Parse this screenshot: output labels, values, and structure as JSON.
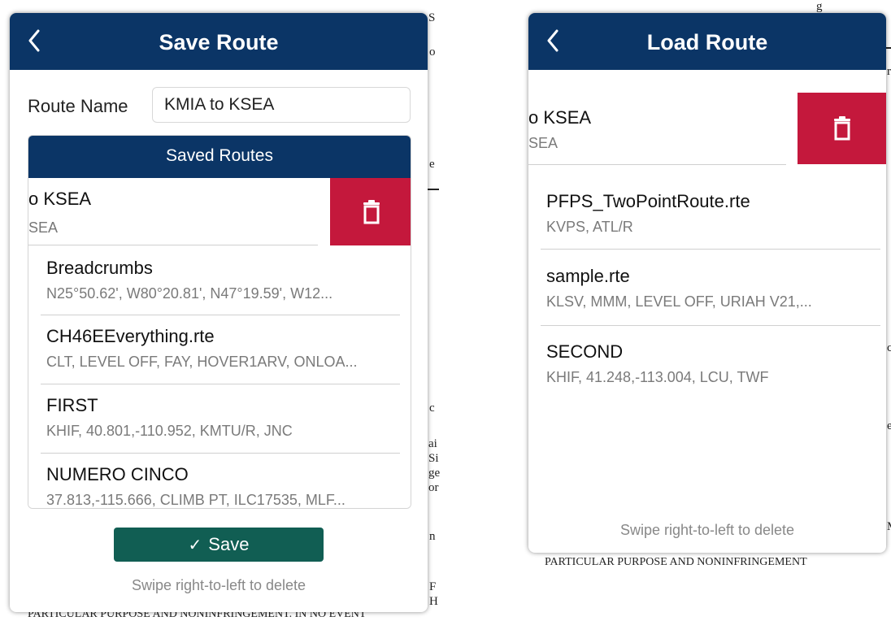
{
  "background_doc": {
    "fragments": [
      "S",
      "o",
      "e",
      "c",
      "ai",
      "Si",
      "ge",
      "or",
      "n",
      "F",
      "H",
      "r",
      "c",
      "e",
      "M",
      "g",
      "PARTICULAR PURPOSE AND NONINFRINGEMENT. IN NO EVENT",
      "PARTICULAR PURPOSE AND NONINFRINGEMENT"
    ]
  },
  "save_panel": {
    "title": "Save Route",
    "route_name_label": "Route Name",
    "route_name_value": "KMIA to KSEA",
    "saved_routes_header": "Saved Routes",
    "swiped_row": {
      "title": "o KSEA",
      "subtitle": "SEA"
    },
    "routes": [
      {
        "name": "Breadcrumbs",
        "points": "N25°50.62', W80°20.81', N47°19.59', W12..."
      },
      {
        "name": "CH46EEverything.rte",
        "points": "CLT, LEVEL OFF, FAY, HOVER1ARV, ONLOA..."
      },
      {
        "name": "FIRST",
        "points": "KHIF, 40.801,-110.952, KMTU/R, JNC"
      },
      {
        "name": "NUMERO CINCO",
        "points": "37.813,-115.666, CLIMB PT, ILC17535, MLF..."
      }
    ],
    "save_button_label": "Save",
    "hint": "Swipe right-to-left to delete"
  },
  "load_panel": {
    "title": "Load Route",
    "swiped_row": {
      "title": "o KSEA",
      "subtitle": "SEA"
    },
    "routes": [
      {
        "name": "PFPS_TwoPointRoute.rte",
        "points": "KVPS, ATL/R"
      },
      {
        "name": "sample.rte",
        "points": "KLSV, MMM, LEVEL OFF, URIAH V21,..."
      },
      {
        "name": "SECOND",
        "points": "KHIF, 41.248,-113.004, LCU, TWF"
      }
    ],
    "hint": "Swipe right-to-left to delete"
  },
  "colors": {
    "header": "#0b3566",
    "delete": "#c4183c",
    "save": "#115e53"
  },
  "icons": {
    "back": "chevron-left-icon",
    "delete": "trash-icon",
    "save": "checkmark-icon"
  }
}
